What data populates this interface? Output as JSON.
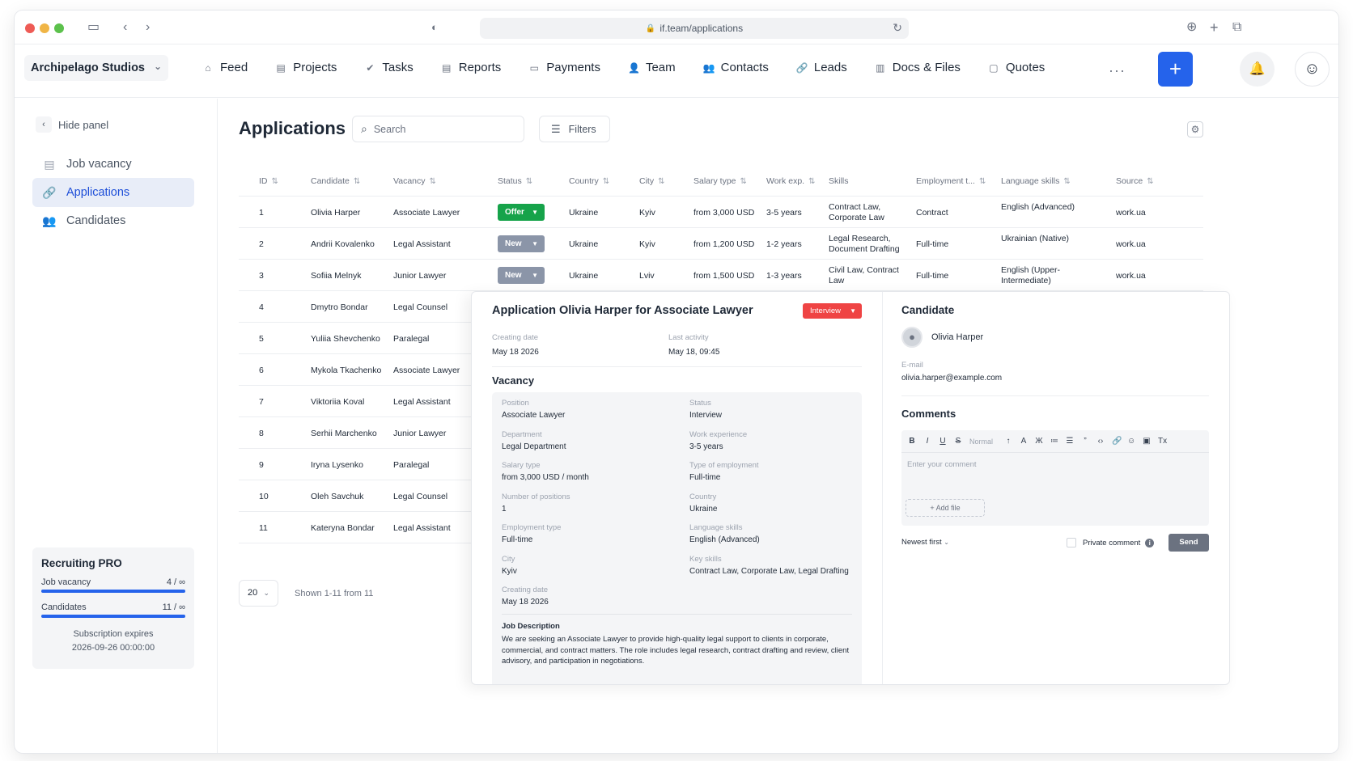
{
  "browser": {
    "url": "if.team/applications",
    "icons": [
      "sidebar-icon",
      "back-icon",
      "forward-icon",
      "shield-icon",
      "reload-icon",
      "download-icon",
      "new-tab-icon",
      "tabs-icon"
    ]
  },
  "header": {
    "company": "Archipelago Studios",
    "nav": [
      {
        "label": "Feed",
        "icon": "home-icon"
      },
      {
        "label": "Projects",
        "icon": "document-icon"
      },
      {
        "label": "Tasks",
        "icon": "check-circle-icon"
      },
      {
        "label": "Reports",
        "icon": "report-icon"
      },
      {
        "label": "Payments",
        "icon": "payments-icon"
      },
      {
        "label": "Team",
        "icon": "person-icon"
      },
      {
        "label": "Contacts",
        "icon": "contacts-icon"
      },
      {
        "label": "Leads",
        "icon": "link-icon"
      },
      {
        "label": "Docs & Files",
        "icon": "folder-icon"
      },
      {
        "label": "Quotes",
        "icon": "quote-doc-icon"
      }
    ],
    "more": "···",
    "add": "+"
  },
  "sidebar": {
    "hide_panel": "Hide panel",
    "items": [
      {
        "label": "Job vacancy",
        "icon": "vacancy-icon"
      },
      {
        "label": "Applications",
        "icon": "link-icon"
      },
      {
        "label": "Candidates",
        "icon": "people-icon"
      }
    ],
    "plan": {
      "title": "Recruiting PRO",
      "rows": [
        {
          "label": "Job vacancy",
          "value": "4 / ∞"
        },
        {
          "label": "Candidates",
          "value": "11 / ∞"
        }
      ],
      "expires_label": "Subscription expires",
      "expires_date": "2026-09-26 00:00:00"
    }
  },
  "main": {
    "title": "Applications",
    "search_placeholder": "Search",
    "filters": "Filters",
    "columns": [
      "ID",
      "Candidate",
      "Vacancy",
      "Status",
      "Country",
      "City",
      "Salary type",
      "Work exp.",
      "Skills",
      "Employment t...",
      "Language skills",
      "Source"
    ],
    "rows": [
      {
        "id": "1",
        "candidate": "Olivia Harper",
        "vacancy": "Associate Lawyer",
        "status": "Offer",
        "country": "Ukraine",
        "city": "Kyiv",
        "salary": "from 3,000 USD",
        "exp": "3-5 years",
        "skills": "Contract Law, Corporate Law",
        "employment": "Contract",
        "language": "English (Advanced)",
        "source": "work.ua"
      },
      {
        "id": "2",
        "candidate": "Andrii Kovalenko",
        "vacancy": "Legal Assistant",
        "status": "New",
        "country": "Ukraine",
        "city": "Kyiv",
        "salary": "from 1,200 USD",
        "exp": "1-2 years",
        "skills": "Legal Research, Document Drafting",
        "employment": "Full-time",
        "language": "Ukrainian (Native)",
        "source": "work.ua"
      },
      {
        "id": "3",
        "candidate": "Sofiia Melnyk",
        "vacancy": "Junior Lawyer",
        "status": "New",
        "country": "Ukraine",
        "city": "Lviv",
        "salary": "from 1,500 USD",
        "exp": "1-3 years",
        "skills": "Civil Law, Contract Law",
        "employment": "Full-time",
        "language": "English (Upper-Intermediate)",
        "source": "work.ua"
      },
      {
        "id": "4",
        "candidate": "Dmytro Bondar",
        "vacancy": "Legal Counsel"
      },
      {
        "id": "5",
        "candidate": "Yuliia Shevchenko",
        "vacancy": "Paralegal"
      },
      {
        "id": "6",
        "candidate": "Mykola Tkachenko",
        "vacancy": "Associate Lawyer"
      },
      {
        "id": "7",
        "candidate": "Viktoriia Koval",
        "vacancy": "Legal Assistant"
      },
      {
        "id": "8",
        "candidate": "Serhii Marchenko",
        "vacancy": "Junior Lawyer"
      },
      {
        "id": "9",
        "candidate": "Iryna Lysenko",
        "vacancy": "Paralegal"
      },
      {
        "id": "10",
        "candidate": "Oleh Savchuk",
        "vacancy": "Legal Counsel"
      },
      {
        "id": "11",
        "candidate": "Kateryna Bondar",
        "vacancy": "Legal Assistant"
      }
    ],
    "page_size": "20",
    "shown": "Shown 1-11 from 11"
  },
  "detail": {
    "title": "Application Olivia Harper for Associate Lawyer",
    "status": "Interview",
    "creating_date_label": "Creating date",
    "creating_date": "May 18 2026",
    "last_activity_label": "Last activity",
    "last_activity": "May 18, 09:45",
    "vacancy_title": "Vacancy",
    "vacancy_fields": [
      {
        "label": "Position",
        "value": "Associate Lawyer"
      },
      {
        "label": "Status",
        "value": "Interview"
      },
      {
        "label": "Department",
        "value": "Legal Department"
      },
      {
        "label": "Work experience",
        "value": "3-5 years"
      },
      {
        "label": "Salary type",
        "value": "from 3,000 USD / month"
      },
      {
        "label": "Type of employment",
        "value": "Full-time"
      },
      {
        "label": "Number of positions",
        "value": "1"
      },
      {
        "label": "Country",
        "value": "Ukraine"
      },
      {
        "label": "Employment type",
        "value": "Full-time"
      },
      {
        "label": "Language skills",
        "value": "English (Advanced)"
      },
      {
        "label": "City",
        "value": "Kyiv"
      },
      {
        "label": "Key skills",
        "value": "Contract Law, Corporate Law, Legal Drafting"
      },
      {
        "label": "Creating date",
        "value": "May 18 2026"
      }
    ],
    "job_description_title": "Job Description",
    "job_description": "We are seeking an Associate Lawyer to provide high-quality legal support to clients in corporate, commercial, and contract matters. The role includes legal research, contract drafting and review, client advisory, and participation in negotiations.",
    "candidate_title": "Candidate",
    "candidate_name": "Olivia Harper",
    "email_label": "E-mail",
    "email": "olivia.harper@example.com",
    "comments_title": "Comments",
    "toolbar": [
      "B",
      "I",
      "U",
      "S",
      "Normal",
      "↑",
      "A",
      "Ж",
      "≔",
      "☰",
      "”",
      "‹›",
      "🔗",
      "☺",
      "▣",
      "Tx"
    ],
    "comment_placeholder": "Enter your comment",
    "add_file": "+ Add file",
    "sort": "Newest first",
    "private_comment": "Private comment",
    "send": "Send"
  },
  "colors": {
    "accent": "#2563eb",
    "offer": "#16a34a",
    "new": "#8b95a8",
    "interview": "#ef4444"
  }
}
